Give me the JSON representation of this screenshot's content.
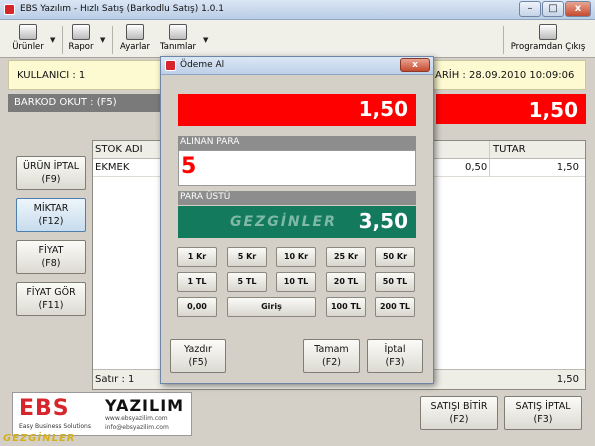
{
  "window": {
    "title": "EBS Yazılım - Hızlı Satış (Barkodlu Satış) 1.0.1",
    "min_label": "–",
    "max_label": "□",
    "close_label": "x"
  },
  "toolbar": {
    "items": [
      {
        "label": "Ürünler",
        "icon": "box-icon"
      },
      {
        "label": "Rapor",
        "icon": "report-icon"
      },
      {
        "label": "Ayarlar",
        "icon": "settings-icon"
      },
      {
        "label": "Tanımlar",
        "icon": "definitions-icon"
      },
      {
        "label": "Programdan Çıkış",
        "icon": "exit-icon"
      }
    ]
  },
  "info": {
    "user": "KULLANICI : 1",
    "date": "ARİH : 28.09.2010 10:09:06"
  },
  "barcode": {
    "label": "BARKOD OKUT : (F5)",
    "total": "1,50"
  },
  "side_buttons": [
    {
      "line1": "ÜRÜN İPTAL",
      "line2": "(F9)"
    },
    {
      "line1": "MİKTAR",
      "line2": "(F12)"
    },
    {
      "line1": "FİYAT",
      "line2": "(F8)"
    },
    {
      "line1": "FİYAT GÖR",
      "line2": "(F11)"
    }
  ],
  "grid": {
    "columns": {
      "stock": "STOK ADI",
      "total": "TUTAR"
    },
    "rows": [
      {
        "name": "EKMEK",
        "price": "0,50",
        "total": "1,50"
      }
    ],
    "footer_count": "Satır : 1",
    "footer_total": "1,50"
  },
  "logo": {
    "ebs": "EBS",
    "yazilim": "YAZILIM",
    "sub": "Easy Business Solutions",
    "web": "www.ebsyazilim.com",
    "mail": "info@ebsyazilim.com"
  },
  "bottom_buttons": [
    {
      "line1": "SATIŞI BİTİR",
      "line2": "(F2)"
    },
    {
      "line1": "SATIŞ İPTAL",
      "line2": "(F3)"
    }
  ],
  "watermark": "GEZGİNLER",
  "dialog": {
    "title": "Ödeme Al",
    "close_label": "x",
    "total": "1,50",
    "received_label": "ALINAN PARA",
    "received_value": "5",
    "change_label": "PARA ÜSTÜ",
    "change_value": "3,50",
    "change_watermark": "GEZGİNLER",
    "keys_row1": [
      "1 Kr",
      "5 Kr",
      "10 Kr",
      "25 Kr",
      "50 Kr"
    ],
    "keys_row2": [
      "1 TL",
      "5 TL",
      "10 TL",
      "20 TL",
      "50 TL"
    ],
    "key_zero": "0,00",
    "key_enter": "Giriş",
    "key_100": "100 TL",
    "key_200": "200 TL",
    "btn_print": {
      "line1": "Yazdır",
      "line2": "(F5)"
    },
    "btn_ok": {
      "line1": "Tamam",
      "line2": "(F2)"
    },
    "btn_cancel": {
      "line1": "İptal",
      "line2": "(F3)"
    }
  }
}
